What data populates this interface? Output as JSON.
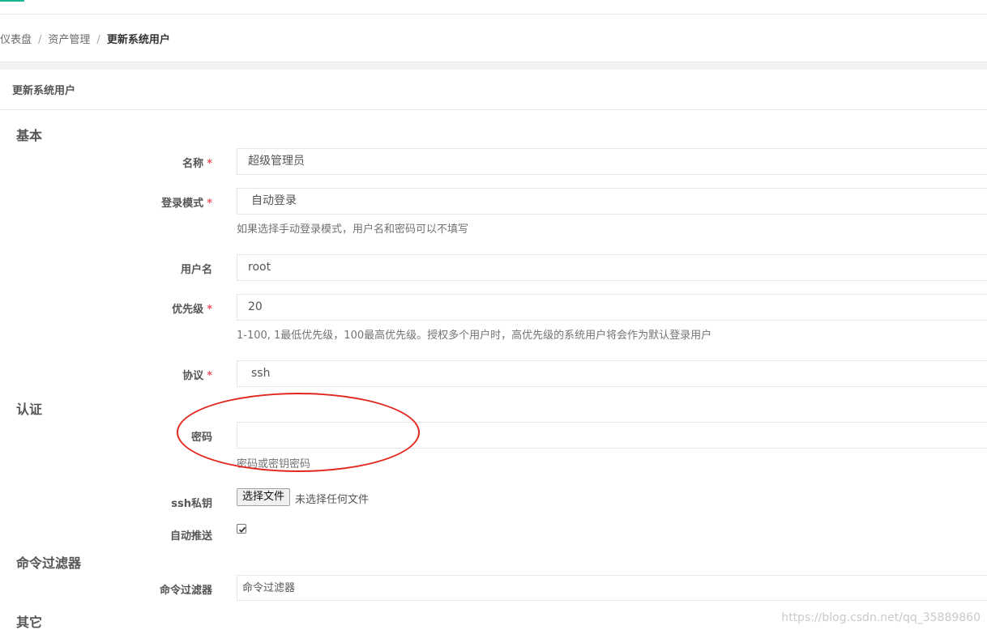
{
  "breadcrumb": [
    "仪表盘",
    "资产管理",
    "更新系统用户"
  ],
  "panel_title": "更新系统用户",
  "sections": {
    "basic": "基本",
    "auth": "认证",
    "cmd_filter": "命令过滤器",
    "other": "其它"
  },
  "form": {
    "name": {
      "label": "名称",
      "value": "超级管理员"
    },
    "login_mode": {
      "label": "登录模式",
      "value": "自动登录",
      "help": "如果选择手动登录模式，用户名和密码可以不填写"
    },
    "username": {
      "label": "用户名",
      "value": "root"
    },
    "priority": {
      "label": "优先级",
      "value": "20",
      "help": "1-100, 1最低优先级，100最高优先级。授权多个用户时，高优先级的系统用户将会作为默认登录用户"
    },
    "protocol": {
      "label": "协议",
      "value": "ssh"
    },
    "password": {
      "label": "密码",
      "value": "",
      "help": "密码或密钥密码"
    },
    "ssh_key": {
      "label": "ssh私钥",
      "button": "选择文件",
      "status": "未选择任何文件"
    },
    "auto_push": {
      "label": "自动推送",
      "checked": true
    },
    "cmd_filter": {
      "label": "命令过滤器",
      "placeholder": "命令过滤器"
    }
  },
  "required_mark": "*",
  "watermark": "https://blog.csdn.net/qq_35889860",
  "colors": {
    "accent": "#1ab394",
    "required": "#ed5565",
    "annotation": "#e1261c"
  }
}
